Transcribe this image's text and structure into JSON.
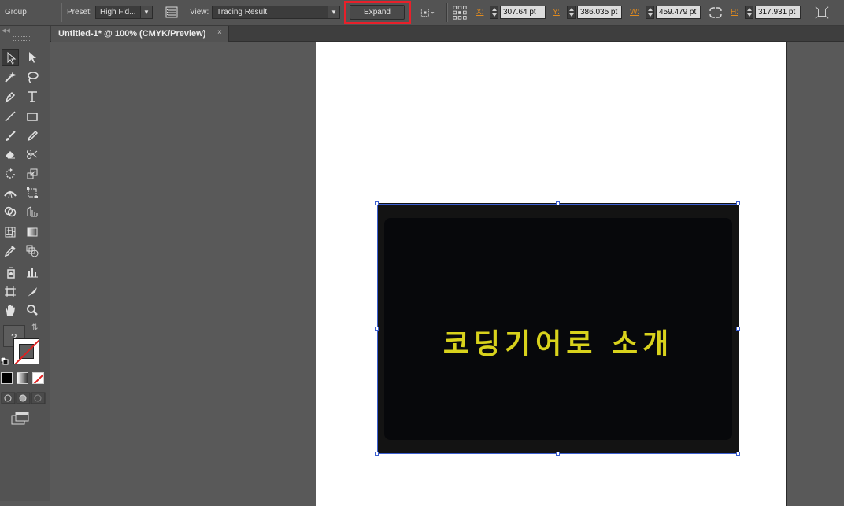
{
  "control_bar": {
    "selection_type": "Group",
    "preset_label": "Preset:",
    "preset_value": "High Fid...",
    "view_label": "View:",
    "view_value": "Tracing Result",
    "expand_label": "Expand",
    "x_label": "X:",
    "x_value": "307.64 pt",
    "y_label": "Y:",
    "y_value": "386.035 pt",
    "w_label": "W:",
    "w_value": "459.479 pt",
    "h_label": "H:",
    "h_value": "317.931 pt"
  },
  "document": {
    "tab_title": "Untitled-1* @ 100% (CMYK/Preview)",
    "close_glyph": "×"
  },
  "artwork": {
    "text": "코딩기어로 소개",
    "text_color": "#d8d21c",
    "background_color": "#07080b"
  },
  "toolbox": {
    "unknown_fill_label": "?"
  },
  "colors": {
    "highlight": "#e8202a",
    "selection": "#3c5fd0",
    "coord_label": "#e08a1e"
  }
}
